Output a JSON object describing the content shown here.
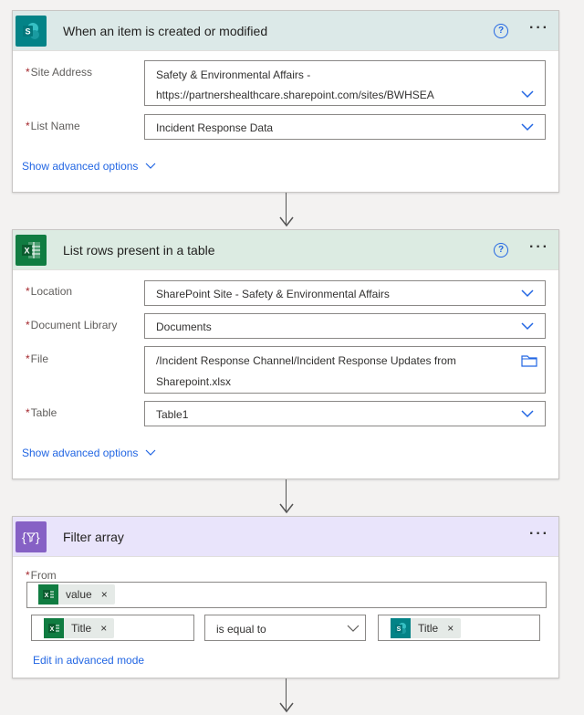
{
  "trigger": {
    "title": "When an item is created or modified",
    "help": "?",
    "more": "···",
    "site_address_label": "Site Address",
    "site_address_line1": "Safety & Environmental Affairs -",
    "site_address_line2": "https://partnershealthcare.sharepoint.com/sites/BWHSEA",
    "list_name_label": "List Name",
    "list_name_value": "Incident Response Data",
    "advanced_link": "Show advanced options"
  },
  "list_rows": {
    "title": "List rows present in a table",
    "help": "?",
    "more": "···",
    "location_label": "Location",
    "location_value": "SharePoint Site - Safety & Environmental Affairs",
    "doclib_label": "Document Library",
    "doclib_value": "Documents",
    "file_label": "File",
    "file_line1": "/Incident Response Channel/Incident Response Updates from",
    "file_line2": "Sharepoint.xlsx",
    "table_label": "Table",
    "table_value": "Table1",
    "advanced_link": "Show advanced options"
  },
  "filter": {
    "title": "Filter array",
    "more": "···",
    "from_label": "From",
    "from_token": "value",
    "left_token": "Title",
    "operator": "is equal to",
    "right_token": "Title",
    "token_close": "×",
    "advanced_link": "Edit in advanced mode"
  },
  "icons": {
    "sharepoint": "sharepoint-icon",
    "excel": "excel-icon",
    "filter": "filter-array-icon"
  },
  "colors": {
    "sharepoint": "#038387",
    "excel": "#107c41",
    "filter": "#8661c5",
    "link": "#2266e3",
    "required": "#a4262c"
  }
}
